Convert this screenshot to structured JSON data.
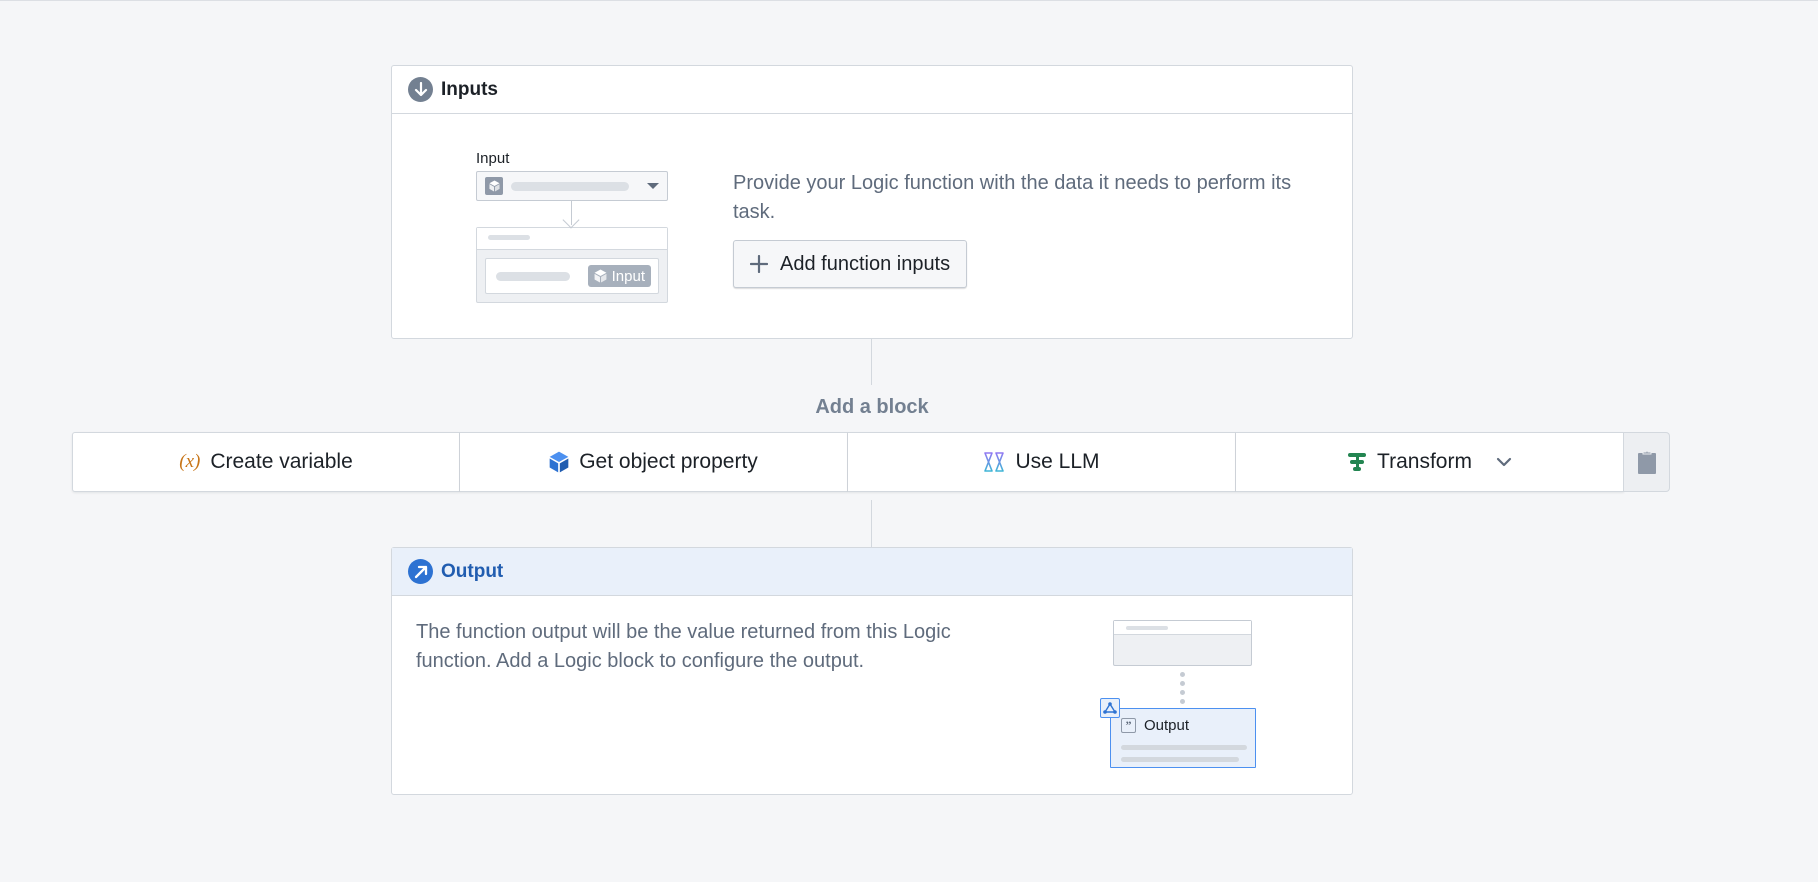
{
  "inputs": {
    "title": "Inputs",
    "header_icon": "arrow-down-circle-icon",
    "illustration": {
      "label": "Input",
      "tag_label": "Input"
    },
    "description": "Provide your Logic function with the data it needs to perform its task.",
    "add_button_label": "Add function inputs"
  },
  "add_block": {
    "label": "Add a block",
    "buttons": [
      {
        "label": "Create variable",
        "icon": "variable-icon",
        "icon_color": "#c87619"
      },
      {
        "label": "Get object property",
        "icon": "cube-icon",
        "icon_color": "#2d72d2"
      },
      {
        "label": "Use LLM",
        "icon": "llm-icon",
        "icon_color": "#8c7cf0"
      },
      {
        "label": "Transform",
        "icon": "transform-icon",
        "icon_color": "#238551",
        "has_dropdown": true
      }
    ],
    "paste_icon": "clipboard-icon"
  },
  "output": {
    "title": "Output",
    "header_icon": "arrow-up-right-circle-icon",
    "description": "The function output will be the value returned from this Logic function. Add a Logic block to configure the output.",
    "illustration": {
      "label": "Output"
    }
  },
  "colors": {
    "background": "#f5f6f8",
    "accent_blue": "#2d72d2",
    "muted_text": "#5f6b7c"
  }
}
